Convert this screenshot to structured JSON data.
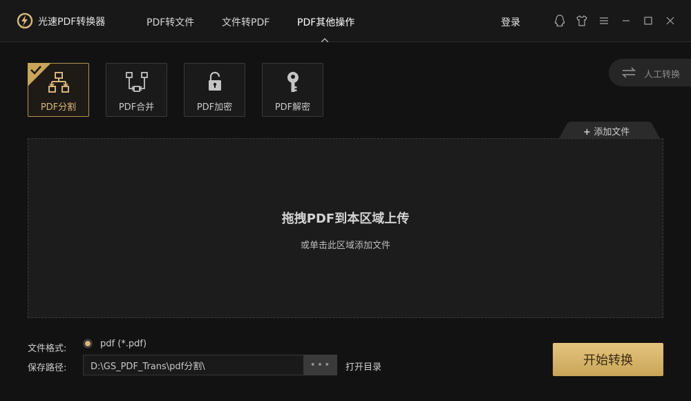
{
  "app": {
    "title": "光速PDF转换器"
  },
  "nav": {
    "items": [
      {
        "label": "PDF转文件"
      },
      {
        "label": "文件转PDF"
      },
      {
        "label": "PDF其他操作"
      }
    ],
    "login": "登录"
  },
  "window_controls": [
    "qq-icon",
    "skin-icon",
    "menu-icon",
    "minimize-icon",
    "maximize-icon",
    "close-icon"
  ],
  "tools": [
    {
      "label": "PDF分割",
      "icon": "split-icon",
      "active": true
    },
    {
      "label": "PDF合并",
      "icon": "merge-icon",
      "active": false
    },
    {
      "label": "PDF加密",
      "icon": "lock-icon",
      "active": false
    },
    {
      "label": "PDF解密",
      "icon": "key-icon",
      "active": false
    }
  ],
  "manual": {
    "label": "人工转换"
  },
  "add_file": {
    "label": "添加文件"
  },
  "dropzone": {
    "title": "拖拽PDF到本区域上传",
    "subtitle": "或单击此区域添加文件"
  },
  "options": {
    "format_label": "文件格式:",
    "format_value": "pdf (*.pdf)",
    "path_label": "保存路径:",
    "path_value": "D:\\GS_PDF_Trans\\pdf分割\\",
    "browse_label": "•••",
    "open_dir": "打开目录"
  },
  "start_button": "开始转换",
  "colors": {
    "accent": "#d9b57a",
    "button_gradient_top": "#e4c47e",
    "button_gradient_bottom": "#c9a558",
    "background": "#121212"
  }
}
